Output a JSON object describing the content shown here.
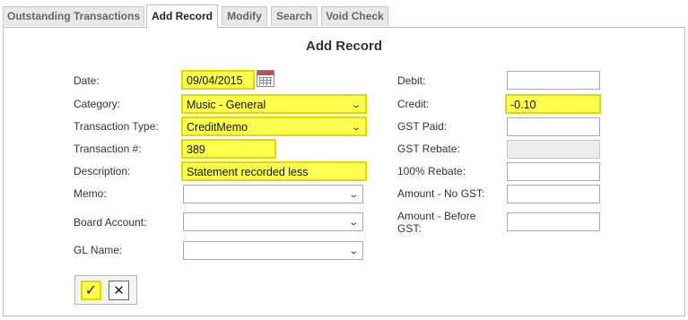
{
  "tabs": [
    {
      "label": "Outstanding Transactions"
    },
    {
      "label": "Add Record"
    },
    {
      "label": "Modify"
    },
    {
      "label": "Search"
    },
    {
      "label": "Void Check"
    }
  ],
  "form": {
    "title": "Add Record",
    "date_label": "Date:",
    "date_value": "09/04/2015",
    "category_label": "Category:",
    "category_value": "Music - General",
    "transaction_type_label": "Transaction Type:",
    "transaction_type_value": "CreditMemo",
    "transaction_num_label": "Transaction #:",
    "transaction_num_value": "389",
    "description_label": "Description:",
    "description_value": "Statement recorded less",
    "memo_label": "Memo:",
    "memo_value": "",
    "board_account_label": "Board Account:",
    "board_account_value": "",
    "gl_name_label": "GL Name:",
    "gl_name_value": "",
    "debit_label": "Debit:",
    "debit_value": "",
    "credit_label": "Credit:",
    "credit_value": "-0.10",
    "gst_paid_label": "GST Paid:",
    "gst_paid_value": "",
    "gst_rebate_label": "GST Rebate:",
    "gst_rebate_value": "",
    "rebate100_label": "100% Rebate:",
    "rebate100_value": "",
    "amount_no_gst_label": "Amount - No GST:",
    "amount_no_gst_value": "",
    "amount_before_gst_label_1": "Amount - Before",
    "amount_before_gst_label_2": "GST:",
    "amount_before_gst_value": ""
  },
  "buttons": {
    "ok_icon": "✓",
    "cancel_icon": "✕"
  },
  "icons": {
    "calendar": "calendar-icon",
    "dropdown": "chevron-down-icon"
  },
  "colors": {
    "highlight": "#ffff4d",
    "highlight_border": "#e6d700"
  }
}
